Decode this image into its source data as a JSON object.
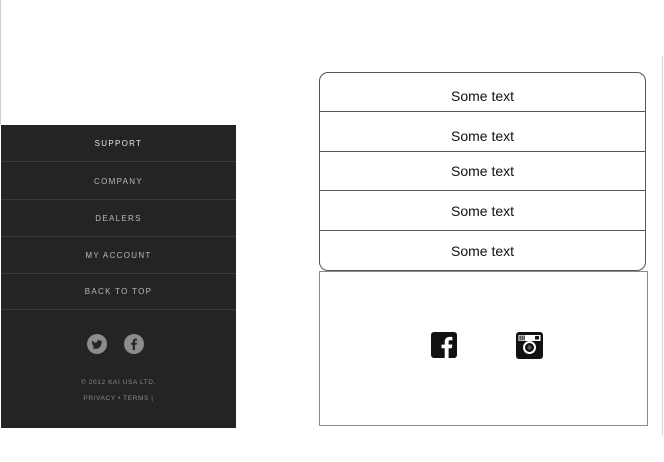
{
  "footer_nav": {
    "items": [
      {
        "label": "SUPPORT"
      },
      {
        "label": "COMPANY"
      },
      {
        "label": "DEALERS"
      },
      {
        "label": "MY ACCOUNT"
      },
      {
        "label": "BACK TO TOP"
      }
    ],
    "social_icons": [
      "twitter-icon",
      "facebook-icon"
    ],
    "copyright": "© 2012 KAI USA LTD.",
    "privacy_label": "PRIVACY",
    "separator": "•",
    "terms_label": "TERMS",
    "trailing_mark": "|"
  },
  "wireframe_list": {
    "rows": [
      {
        "label": "Some text"
      },
      {
        "label": "Some text"
      },
      {
        "label": "Some text"
      },
      {
        "label": "Some text"
      },
      {
        "label": "Some text"
      }
    ]
  },
  "wireframe_social": {
    "icons": [
      "facebook-icon",
      "instagram-icon"
    ]
  },
  "colors": {
    "panel_bg": "#242424",
    "panel_text": "#b8b8b8",
    "wire_border": "#555555"
  }
}
